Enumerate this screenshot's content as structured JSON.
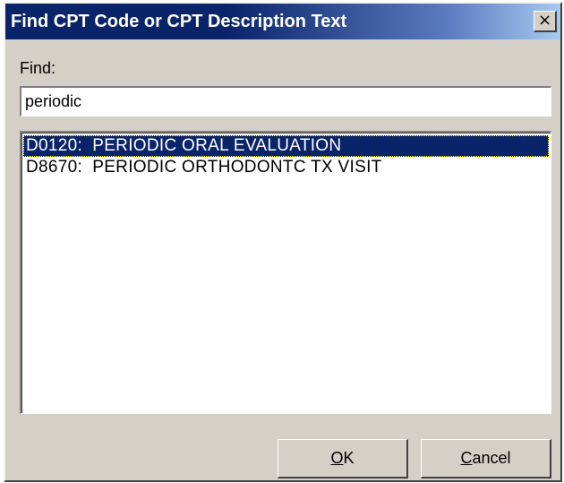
{
  "window": {
    "title": "Find CPT Code or CPT Description Text",
    "close_glyph": "×"
  },
  "find": {
    "label": "Find:",
    "value": "periodic"
  },
  "results": [
    {
      "text": "D0120:  PERIODIC ORAL EVALUATION",
      "selected": true
    },
    {
      "text": "D8670:  PERIODIC ORTHODONTC TX VISIT",
      "selected": false
    }
  ],
  "buttons": {
    "ok_mnemonic": "O",
    "ok_rest": "K",
    "cancel_mnemonic": "C",
    "cancel_rest": "ancel"
  },
  "colors": {
    "title_bar": "#0a246a",
    "selection": "#0a246a",
    "face": "#d4d0c8"
  }
}
